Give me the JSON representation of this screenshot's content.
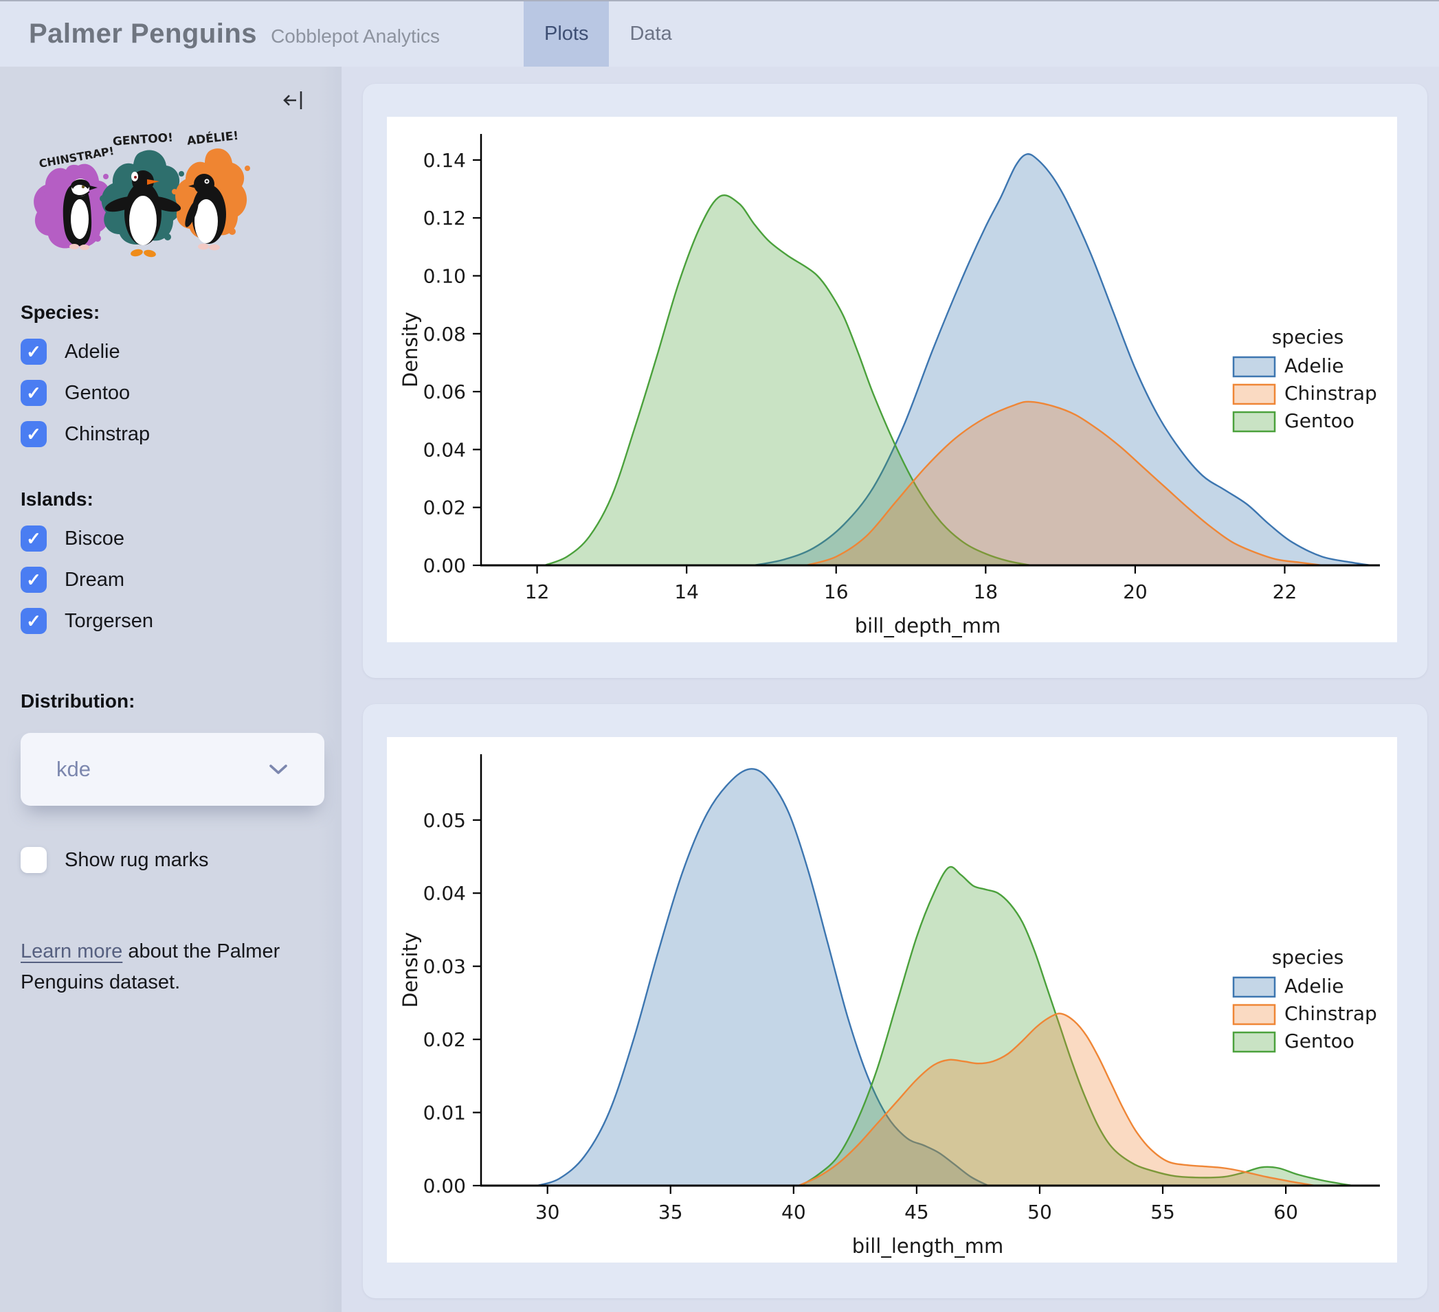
{
  "app": {
    "title": "Palmer Penguins",
    "subtitle": "Cobblepot Analytics"
  },
  "tabs": [
    {
      "label": "Plots",
      "active": true
    },
    {
      "label": "Data",
      "active": false
    }
  ],
  "sidebar": {
    "collapse_icon": "arrow-left-to-bar",
    "artwork": {
      "labels": [
        "CHINSTRAP!",
        "GENTOO!",
        "ADÉLIE!"
      ]
    },
    "species": {
      "heading": "Species:",
      "options": [
        {
          "label": "Adelie",
          "checked": true
        },
        {
          "label": "Gentoo",
          "checked": true
        },
        {
          "label": "Chinstrap",
          "checked": true
        }
      ]
    },
    "islands": {
      "heading": "Islands:",
      "options": [
        {
          "label": "Biscoe",
          "checked": true
        },
        {
          "label": "Dream",
          "checked": true
        },
        {
          "label": "Torgersen",
          "checked": true
        }
      ]
    },
    "distribution": {
      "heading": "Distribution:",
      "selected": "kde"
    },
    "rug": {
      "label": "Show rug marks",
      "checked": false
    },
    "footer": {
      "link_text": "Learn more",
      "text_after": " about the Palmer Penguins dataset."
    }
  },
  "colors": {
    "header_bg": "#dee4f2",
    "tab_active_bg": "#b9c7e3",
    "sidebar_bg": "#d2d7e4",
    "main_bg": "#dadfee",
    "card_bg": "#e2e8f5",
    "checkbox_blue": "#4a7df2",
    "adelie_blue": "#3d76b0",
    "chinstrap_orange": "#ef8636",
    "gentoo_green": "#4ba13c",
    "splash_magenta": "#b55ec4",
    "splash_teal": "#2e6f6d",
    "splash_orange": "#ef8532"
  },
  "chart_data": [
    {
      "type": "area",
      "kind": "kde",
      "xlabel": "bill_depth_mm",
      "ylabel": "Density",
      "xlim": [
        11.25,
        23.2
      ],
      "ylim": [
        0,
        0.149
      ],
      "xticks": [
        12,
        14,
        16,
        18,
        20,
        22
      ],
      "xtick_labels": [
        "12",
        "14",
        "16",
        "18",
        "20",
        "22"
      ],
      "yticks": [
        0,
        0.02,
        0.04,
        0.06,
        0.08,
        0.1,
        0.12,
        0.14
      ],
      "ytick_labels": [
        "0.00",
        "0.02",
        "0.04",
        "0.06",
        "0.08",
        "0.10",
        "0.12",
        "0.14"
      ],
      "legend_title": "species",
      "legend_order": [
        "Adelie",
        "Chinstrap",
        "Gentoo"
      ],
      "series": [
        {
          "name": "Adelie",
          "color": "#3d76b0",
          "fill": "rgba(61,118,176,0.30)",
          "points": [
            [
              14.9,
              0
            ],
            [
              15.3,
              0.002
            ],
            [
              15.7,
              0.006
            ],
            [
              16.1,
              0.014
            ],
            [
              16.5,
              0.027
            ],
            [
              16.9,
              0.048
            ],
            [
              17.3,
              0.075
            ],
            [
              17.7,
              0.1
            ],
            [
              18.0,
              0.117
            ],
            [
              18.2,
              0.127
            ],
            [
              18.4,
              0.138
            ],
            [
              18.55,
              0.142
            ],
            [
              18.7,
              0.14
            ],
            [
              18.9,
              0.134
            ],
            [
              19.1,
              0.125
            ],
            [
              19.4,
              0.108
            ],
            [
              19.7,
              0.088
            ],
            [
              20.0,
              0.068
            ],
            [
              20.3,
              0.052
            ],
            [
              20.6,
              0.04
            ],
            [
              20.9,
              0.031
            ],
            [
              21.2,
              0.026
            ],
            [
              21.5,
              0.021
            ],
            [
              21.8,
              0.014
            ],
            [
              22.1,
              0.008
            ],
            [
              22.5,
              0.003
            ],
            [
              22.9,
              0.001
            ],
            [
              23.15,
              0
            ]
          ]
        },
        {
          "name": "Gentoo",
          "color": "#4ba13c",
          "fill": "rgba(75,161,60,0.30)",
          "points": [
            [
              12.1,
              0
            ],
            [
              12.4,
              0.003
            ],
            [
              12.7,
              0.01
            ],
            [
              13.0,
              0.024
            ],
            [
              13.3,
              0.047
            ],
            [
              13.6,
              0.072
            ],
            [
              13.9,
              0.098
            ],
            [
              14.2,
              0.118
            ],
            [
              14.45,
              0.1275
            ],
            [
              14.7,
              0.125
            ],
            [
              14.9,
              0.118
            ],
            [
              15.1,
              0.112
            ],
            [
              15.35,
              0.107
            ],
            [
              15.6,
              0.103
            ],
            [
              15.75,
              0.1
            ],
            [
              15.9,
              0.095
            ],
            [
              16.1,
              0.086
            ],
            [
              16.3,
              0.073
            ],
            [
              16.5,
              0.059
            ],
            [
              16.8,
              0.041
            ],
            [
              17.1,
              0.026
            ],
            [
              17.4,
              0.015
            ],
            [
              17.7,
              0.008
            ],
            [
              18.0,
              0.004
            ],
            [
              18.3,
              0.0015
            ],
            [
              18.6,
              0
            ]
          ]
        },
        {
          "name": "Chinstrap",
          "color": "#ef8636",
          "fill": "rgba(239,134,54,0.30)",
          "points": [
            [
              15.6,
              0
            ],
            [
              16.0,
              0.003
            ],
            [
              16.4,
              0.01
            ],
            [
              16.8,
              0.022
            ],
            [
              17.2,
              0.034
            ],
            [
              17.6,
              0.044
            ],
            [
              18.0,
              0.051
            ],
            [
              18.4,
              0.0555
            ],
            [
              18.6,
              0.0565
            ],
            [
              18.9,
              0.055
            ],
            [
              19.2,
              0.052
            ],
            [
              19.5,
              0.047
            ],
            [
              19.8,
              0.041
            ],
            [
              20.1,
              0.034
            ],
            [
              20.4,
              0.027
            ],
            [
              20.7,
              0.02
            ],
            [
              21.0,
              0.0135
            ],
            [
              21.3,
              0.008
            ],
            [
              21.6,
              0.0045
            ],
            [
              21.9,
              0.002
            ],
            [
              22.2,
              0.001
            ],
            [
              22.5,
              0
            ]
          ]
        }
      ]
    },
    {
      "type": "area",
      "kind": "kde",
      "xlabel": "bill_length_mm",
      "ylabel": "Density",
      "xlim": [
        27.3,
        63.6
      ],
      "ylim": [
        0,
        0.059
      ],
      "xticks": [
        30,
        35,
        40,
        45,
        50,
        55,
        60
      ],
      "xtick_labels": [
        "30",
        "35",
        "40",
        "45",
        "50",
        "55",
        "60"
      ],
      "yticks": [
        0,
        0.01,
        0.02,
        0.03,
        0.04,
        0.05
      ],
      "ytick_labels": [
        "0.00",
        "0.01",
        "0.02",
        "0.03",
        "0.04",
        "0.05"
      ],
      "legend_title": "species",
      "legend_order": [
        "Adelie",
        "Chinstrap",
        "Gentoo"
      ],
      "series": [
        {
          "name": "Adelie",
          "color": "#3d76b0",
          "fill": "rgba(61,118,176,0.30)",
          "points": [
            [
              29.6,
              0
            ],
            [
              30.5,
              0.001
            ],
            [
              31.5,
              0.004
            ],
            [
              32.5,
              0.01
            ],
            [
              33.5,
              0.02
            ],
            [
              34.5,
              0.032
            ],
            [
              35.5,
              0.043
            ],
            [
              36.5,
              0.051
            ],
            [
              37.5,
              0.0555
            ],
            [
              38.3,
              0.057
            ],
            [
              39.0,
              0.0555
            ],
            [
              39.8,
              0.051
            ],
            [
              40.6,
              0.043
            ],
            [
              41.4,
              0.033
            ],
            [
              42.2,
              0.023
            ],
            [
              43.0,
              0.015
            ],
            [
              43.8,
              0.0095
            ],
            [
              44.6,
              0.0065
            ],
            [
              45.3,
              0.0055
            ],
            [
              45.9,
              0.0045
            ],
            [
              46.5,
              0.003
            ],
            [
              47.2,
              0.0012
            ],
            [
              47.9,
              0
            ]
          ]
        },
        {
          "name": "Gentoo",
          "color": "#4ba13c",
          "fill": "rgba(75,161,60,0.30)",
          "points": [
            [
              40.3,
              0
            ],
            [
              41.0,
              0.0015
            ],
            [
              41.8,
              0.004
            ],
            [
              42.6,
              0.009
            ],
            [
              43.4,
              0.016
            ],
            [
              44.2,
              0.025
            ],
            [
              45.0,
              0.034
            ],
            [
              45.7,
              0.04
            ],
            [
              46.3,
              0.0435
            ],
            [
              46.8,
              0.0425
            ],
            [
              47.3,
              0.041
            ],
            [
              47.8,
              0.0405
            ],
            [
              48.3,
              0.04
            ],
            [
              48.8,
              0.0385
            ],
            [
              49.3,
              0.036
            ],
            [
              49.8,
              0.032
            ],
            [
              50.3,
              0.027
            ],
            [
              50.8,
              0.022
            ],
            [
              51.3,
              0.017
            ],
            [
              51.8,
              0.0125
            ],
            [
              52.4,
              0.008
            ],
            [
              53.0,
              0.005
            ],
            [
              53.8,
              0.003
            ],
            [
              54.6,
              0.002
            ],
            [
              55.5,
              0.0013
            ],
            [
              56.5,
              0.0011
            ],
            [
              57.5,
              0.0012
            ],
            [
              58.3,
              0.0018
            ],
            [
              59.0,
              0.0025
            ],
            [
              59.7,
              0.0024
            ],
            [
              60.5,
              0.0015
            ],
            [
              61.5,
              0.0007
            ],
            [
              62.7,
              0
            ]
          ]
        },
        {
          "name": "Chinstrap",
          "color": "#ef8636",
          "fill": "rgba(239,134,54,0.30)",
          "points": [
            [
              40.2,
              0
            ],
            [
              41.0,
              0.0012
            ],
            [
              41.8,
              0.003
            ],
            [
              42.6,
              0.0055
            ],
            [
              43.4,
              0.0085
            ],
            [
              44.2,
              0.0115
            ],
            [
              45.0,
              0.0145
            ],
            [
              45.7,
              0.0165
            ],
            [
              46.3,
              0.0172
            ],
            [
              46.9,
              0.017
            ],
            [
              47.5,
              0.0167
            ],
            [
              48.1,
              0.017
            ],
            [
              48.7,
              0.018
            ],
            [
              49.3,
              0.0198
            ],
            [
              49.9,
              0.0218
            ],
            [
              50.5,
              0.0232
            ],
            [
              50.9,
              0.0235
            ],
            [
              51.4,
              0.0225
            ],
            [
              51.9,
              0.0205
            ],
            [
              52.4,
              0.0175
            ],
            [
              52.9,
              0.014
            ],
            [
              53.4,
              0.0105
            ],
            [
              53.9,
              0.0075
            ],
            [
              54.5,
              0.005
            ],
            [
              55.2,
              0.0033
            ],
            [
              56.0,
              0.0028
            ],
            [
              56.8,
              0.0026
            ],
            [
              57.5,
              0.0024
            ],
            [
              58.3,
              0.0019
            ],
            [
              59.2,
              0.0012
            ],
            [
              60.3,
              0.0005
            ],
            [
              61.2,
              0
            ]
          ]
        }
      ]
    }
  ]
}
